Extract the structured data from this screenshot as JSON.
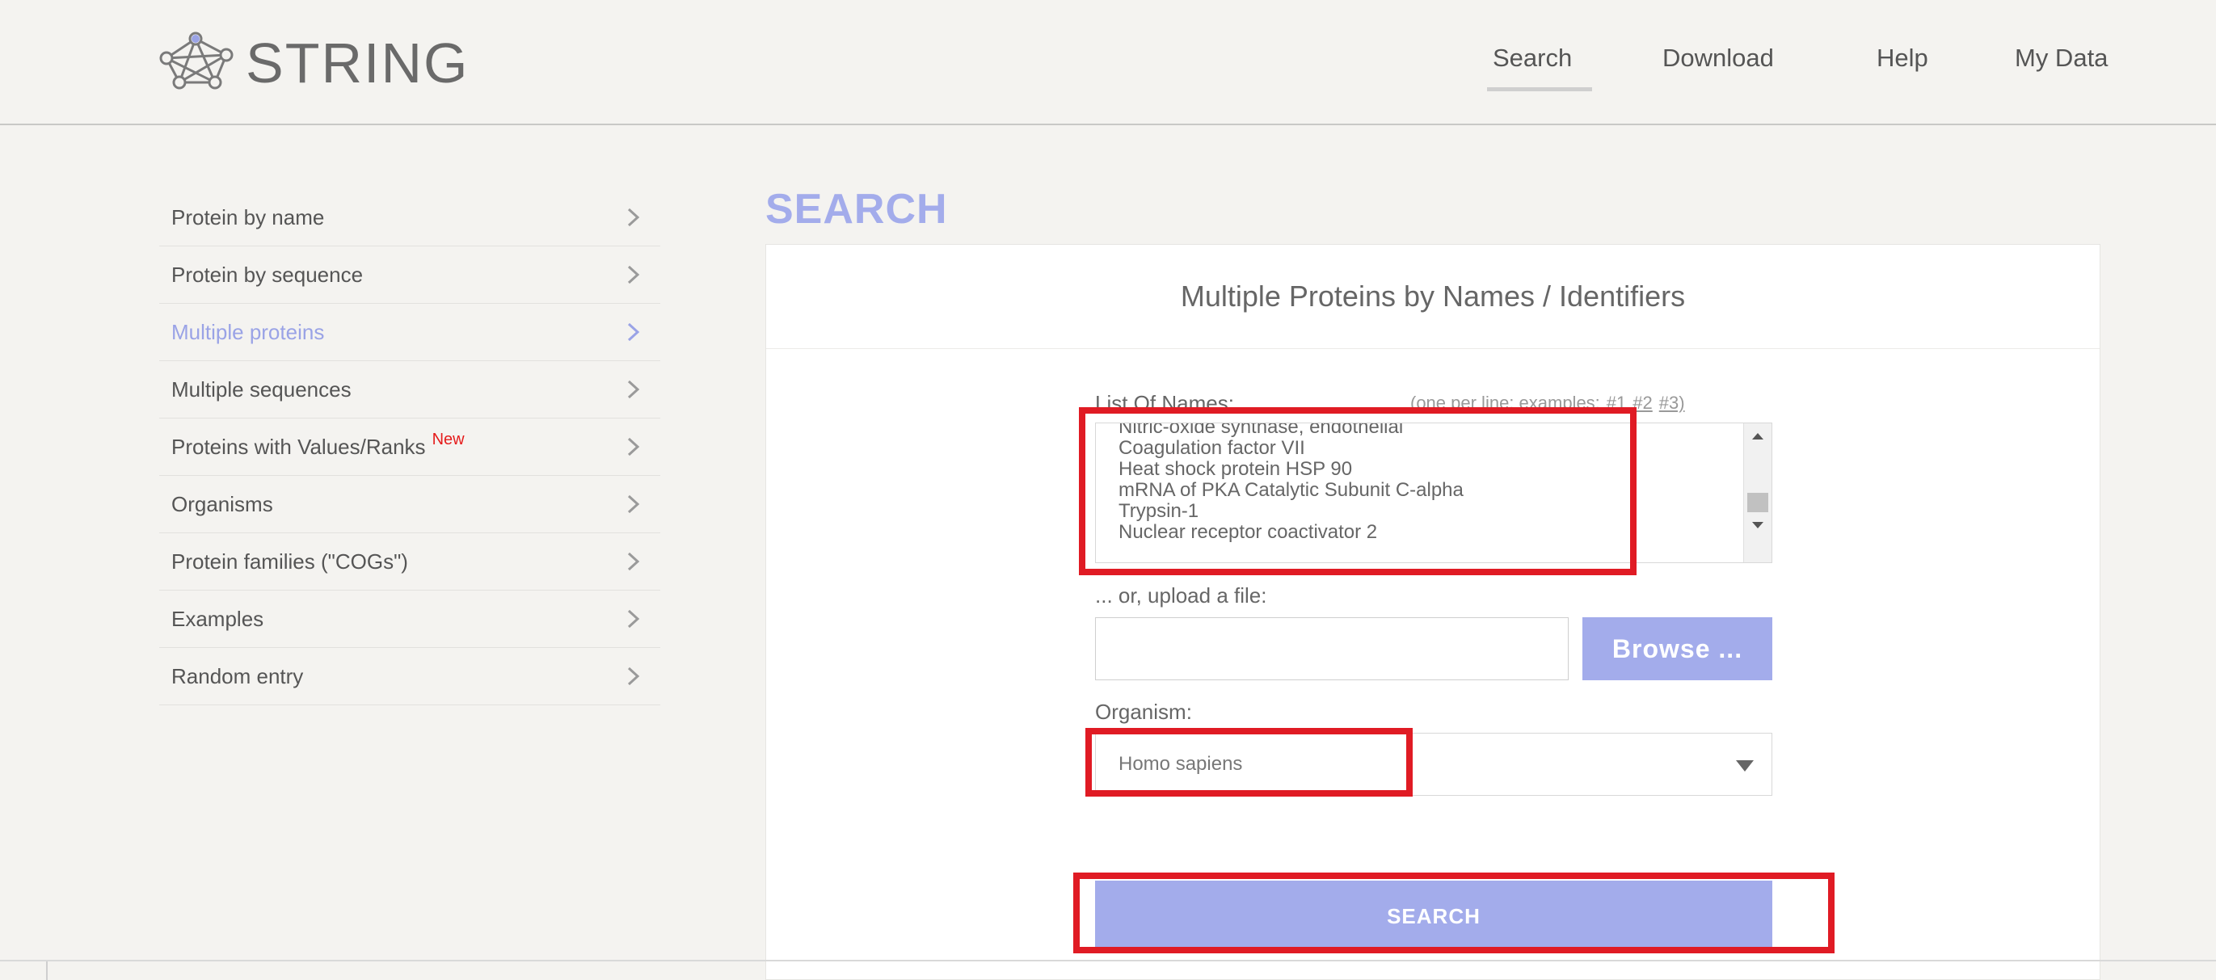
{
  "header": {
    "logo_text": "STRING",
    "nav": [
      "Search",
      "Download",
      "Help",
      "My Data"
    ]
  },
  "sidebar": {
    "items": [
      {
        "label": "Protein by name"
      },
      {
        "label": "Protein by sequence"
      },
      {
        "label": "Multiple proteins",
        "active": true
      },
      {
        "label": "Multiple sequences"
      },
      {
        "label": "Proteins with Values/Ranks",
        "badge": "New"
      },
      {
        "label": "Organisms"
      },
      {
        "label": "Protein families (\"COGs\")"
      },
      {
        "label": "Examples"
      },
      {
        "label": "Random entry"
      }
    ]
  },
  "main": {
    "title": "SEARCH",
    "card_title": "Multiple Proteins by Names / Identifiers",
    "list_label": "List Of Names:",
    "examples_prefix": "(one per line; examples:",
    "examples_links": [
      "#1",
      "#2",
      "#3)"
    ],
    "names": [
      "Nitric-oxide synthase, endothelial",
      "Coagulation factor VII",
      "Heat shock protein HSP 90",
      "mRNA of PKA Catalytic Subunit C-alpha",
      "Trypsin-1",
      "Nuclear receptor coactivator 2"
    ],
    "upload_label": "... or, upload a file:",
    "browse_label": "Browse ...",
    "organism_label": "Organism:",
    "organism_value": "Homo sapiens",
    "search_button": "SEARCH"
  },
  "colors": {
    "accent": "#a3aceb",
    "highlight": "#e01b24",
    "new_badge": "#e51b1b"
  }
}
